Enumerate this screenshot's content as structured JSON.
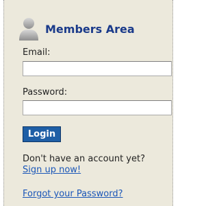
{
  "header": {
    "title": "Members Area",
    "icon": "user-icon"
  },
  "form": {
    "email_label": "Email:",
    "email_value": "",
    "password_label": "Password:",
    "password_value": "",
    "login_label": "Login"
  },
  "footer": {
    "no_account_text": "Don't have an account yet?",
    "signup_link": "Sign up now!",
    "forgot_link": "Forgot your Password?"
  },
  "colors": {
    "panel_bg": "#ece9dc",
    "title": "#1a3a8a",
    "button_bg": "#1f5fa6",
    "link": "#1a56b8"
  }
}
